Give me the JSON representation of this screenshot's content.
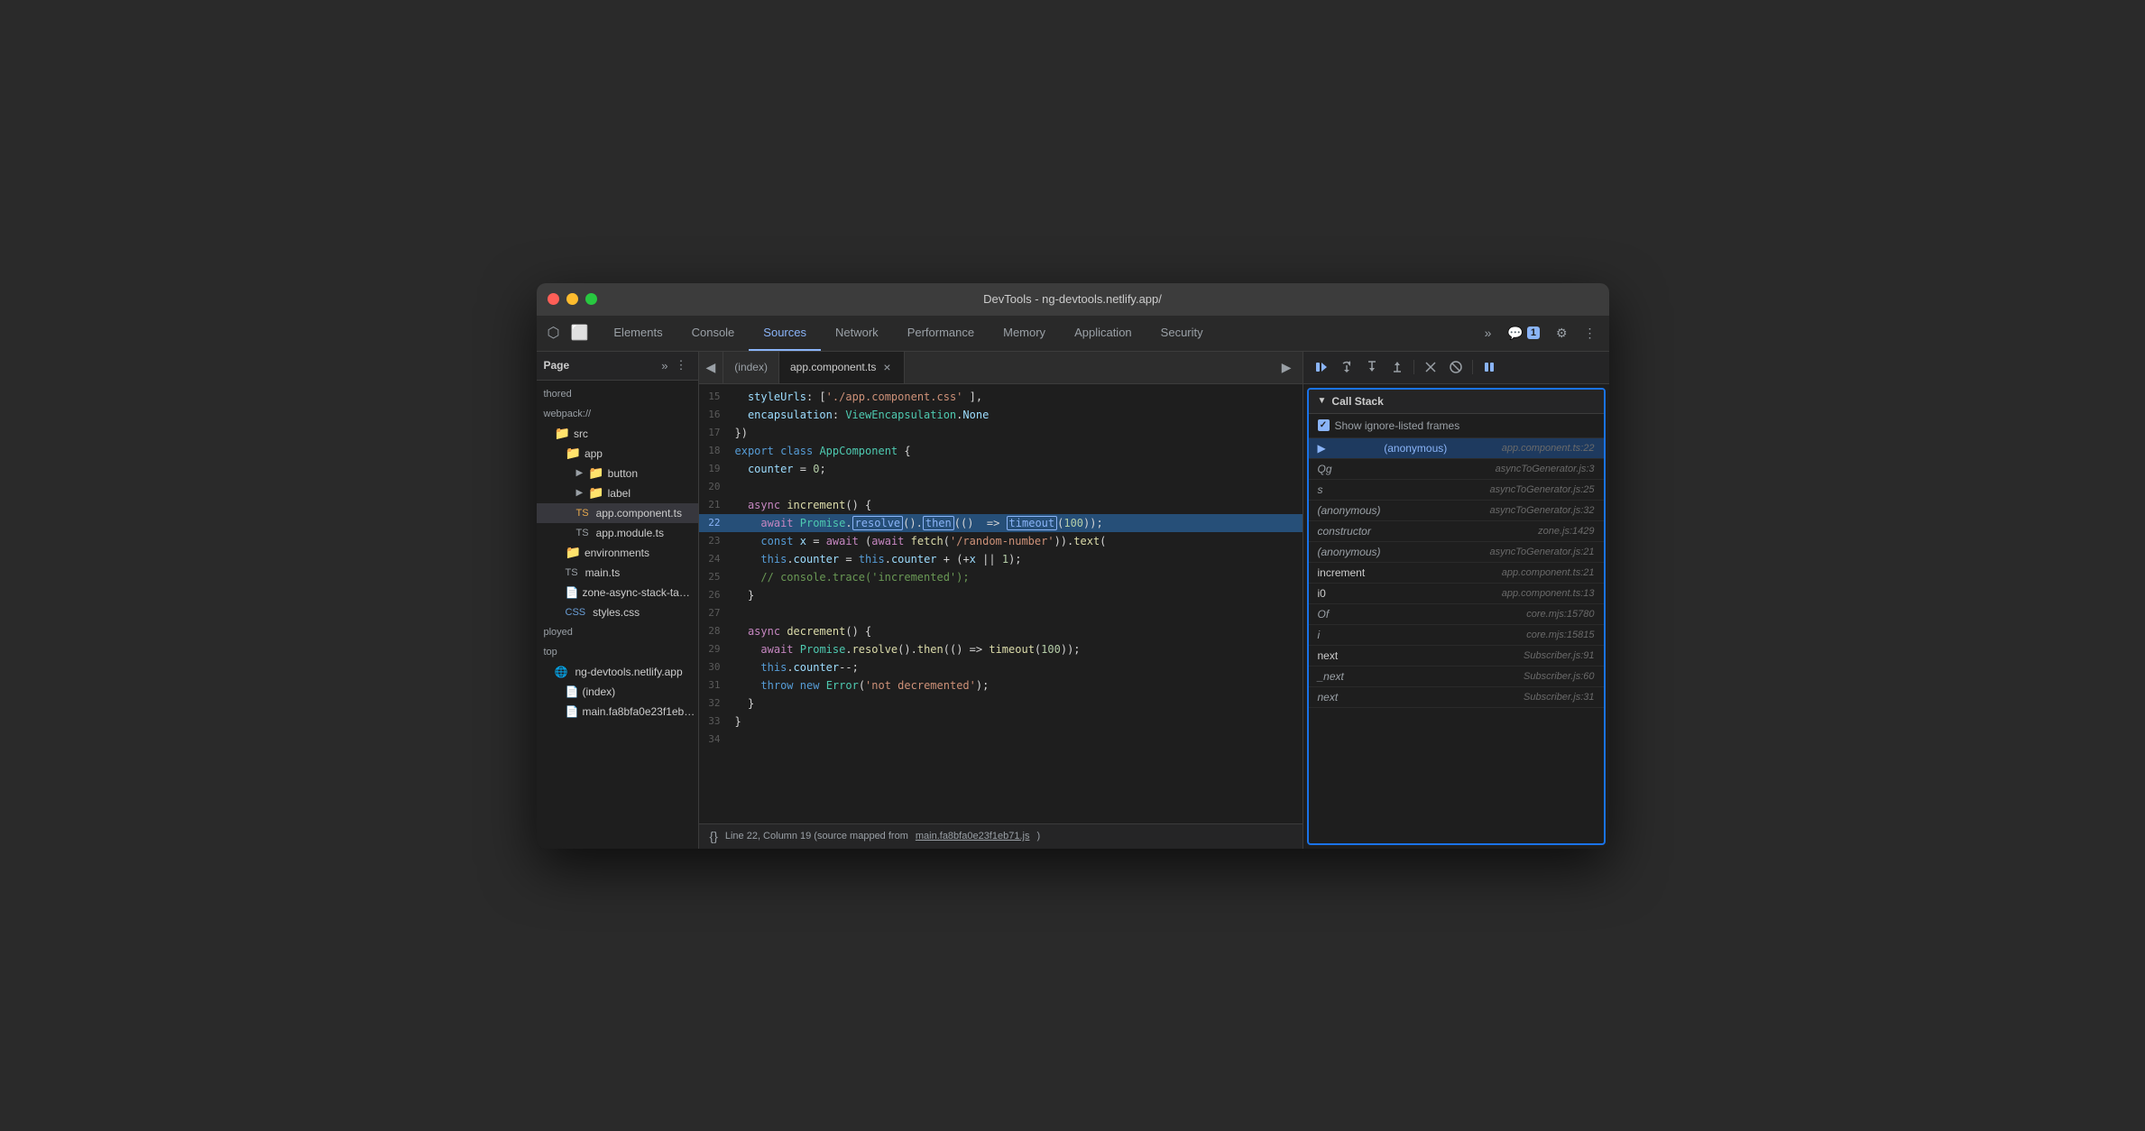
{
  "window": {
    "title": "DevTools - ng-devtools.netlify.app/"
  },
  "tabs": {
    "items": [
      {
        "id": "elements",
        "label": "Elements",
        "active": false
      },
      {
        "id": "console",
        "label": "Console",
        "active": false
      },
      {
        "id": "sources",
        "label": "Sources",
        "active": true
      },
      {
        "id": "network",
        "label": "Network",
        "active": false
      },
      {
        "id": "performance",
        "label": "Performance",
        "active": false
      },
      {
        "id": "memory",
        "label": "Memory",
        "active": false
      },
      {
        "id": "application",
        "label": "Application",
        "active": false
      },
      {
        "id": "security",
        "label": "Security",
        "active": false
      }
    ],
    "more_label": "»",
    "notification_badge": "1",
    "settings_icon": "⚙",
    "more_icon": "⋮"
  },
  "sidebar": {
    "header_label": "Page",
    "more_icon": "»",
    "menu_icon": "⋮",
    "items": [
      {
        "label": "thored",
        "indent": 0,
        "type": "text"
      },
      {
        "label": "webpack://",
        "indent": 0,
        "type": "text"
      },
      {
        "label": "src",
        "indent": 1,
        "type": "folder_orange"
      },
      {
        "label": "app",
        "indent": 2,
        "type": "folder_orange"
      },
      {
        "label": "button",
        "indent": 3,
        "type": "folder_orange",
        "has_arrow": true
      },
      {
        "label": "label",
        "indent": 3,
        "type": "folder_orange",
        "has_arrow": true
      },
      {
        "label": "app.component.ts",
        "indent": 3,
        "type": "file_ts",
        "active": true
      },
      {
        "label": "app.module.ts",
        "indent": 3,
        "type": "file_ts"
      },
      {
        "label": "environments",
        "indent": 2,
        "type": "folder_orange"
      },
      {
        "label": "main.ts",
        "indent": 2,
        "type": "file_ts"
      },
      {
        "label": "zone-async-stack-ta…",
        "indent": 2,
        "type": "file"
      },
      {
        "label": "styles.css",
        "indent": 2,
        "type": "file_css"
      },
      {
        "label": "ployed",
        "indent": 0,
        "type": "text"
      },
      {
        "label": "top",
        "indent": 0,
        "type": "text"
      },
      {
        "label": "ng-devtools.netlify.app",
        "indent": 1,
        "type": "globe"
      },
      {
        "label": "(index)",
        "indent": 2,
        "type": "file"
      },
      {
        "label": "main.fa8bfa0e23f1eb…",
        "indent": 2,
        "type": "file"
      }
    ]
  },
  "editor": {
    "back_btn": "◀",
    "tabs": [
      {
        "label": "(index)",
        "active": false
      },
      {
        "label": "app.component.ts",
        "active": true,
        "closeable": true
      }
    ],
    "lines": [
      {
        "num": 15,
        "content": "  styleUrls: ['./app.component.css' ],",
        "type": "normal"
      },
      {
        "num": 16,
        "content": "  encapsulation: ViewEncapsulation.None",
        "type": "normal"
      },
      {
        "num": 17,
        "content": "})",
        "type": "normal"
      },
      {
        "num": 18,
        "content": "export class AppComponent {",
        "type": "normal"
      },
      {
        "num": 19,
        "content": "  counter = 0;",
        "type": "normal"
      },
      {
        "num": 20,
        "content": "",
        "type": "normal"
      },
      {
        "num": 21,
        "content": "  async increment() {",
        "type": "normal"
      },
      {
        "num": 22,
        "content": "    await Promise.resolve().then(() => timeout(100));",
        "type": "highlighted",
        "has_breakpoint": true
      },
      {
        "num": 23,
        "content": "    const x = await (await fetch('/random-number')).text(",
        "type": "normal"
      },
      {
        "num": 24,
        "content": "    this.counter = this.counter + (+x || 1);",
        "type": "normal"
      },
      {
        "num": 25,
        "content": "    // console.trace('incremented');",
        "type": "normal"
      },
      {
        "num": 26,
        "content": "  }",
        "type": "normal"
      },
      {
        "num": 27,
        "content": "",
        "type": "normal"
      },
      {
        "num": 28,
        "content": "  async decrement() {",
        "type": "normal"
      },
      {
        "num": 29,
        "content": "    await Promise.resolve().then(() => timeout(100));",
        "type": "normal"
      },
      {
        "num": 30,
        "content": "    this.counter--;",
        "type": "normal"
      },
      {
        "num": 31,
        "content": "    throw new Error('not decremented');",
        "type": "normal"
      },
      {
        "num": 32,
        "content": "  }",
        "type": "normal"
      },
      {
        "num": 33,
        "content": "}",
        "type": "normal"
      },
      {
        "num": 34,
        "content": "",
        "type": "normal"
      }
    ]
  },
  "status_bar": {
    "curly": "{}",
    "text": "Line 22, Column 19 (source mapped from",
    "link": "main.fa8bfa0e23f1eb71.js",
    "text2": ")"
  },
  "debugger": {
    "toolbar_buttons": [
      {
        "id": "resume",
        "icon": "▶",
        "label": "Resume",
        "active": true
      },
      {
        "id": "step-over",
        "icon": "↺",
        "label": "Step over"
      },
      {
        "id": "step-into",
        "icon": "↓",
        "label": "Step into"
      },
      {
        "id": "step-out",
        "icon": "↑",
        "label": "Step out"
      },
      {
        "id": "deactivate",
        "icon": "⤢",
        "label": "Deactivate"
      },
      {
        "id": "no-pause",
        "icon": "⊘",
        "label": "No pause"
      },
      {
        "id": "pause",
        "icon": "⏸",
        "label": "Pause",
        "active_blue": true
      }
    ],
    "call_stack": {
      "title": "Call Stack",
      "show_ignored_frames_label": "Show ignore-listed frames",
      "items": [
        {
          "name": "(anonymous)",
          "file": "app.component.ts:22",
          "current": true,
          "italic": false
        },
        {
          "name": "Qg",
          "file": "asyncToGenerator.js:3",
          "current": false,
          "italic": true
        },
        {
          "name": "s",
          "file": "asyncToGenerator.js:25",
          "current": false,
          "italic": true
        },
        {
          "name": "(anonymous)",
          "file": "asyncToGenerator.js:32",
          "current": false,
          "italic": true
        },
        {
          "name": "constructor",
          "file": "zone.js:1429",
          "current": false,
          "italic": true
        },
        {
          "name": "(anonymous)",
          "file": "asyncToGenerator.js:21",
          "current": false,
          "italic": true
        },
        {
          "name": "increment",
          "file": "app.component.ts:21",
          "current": false,
          "italic": false
        },
        {
          "name": "i0",
          "file": "app.component.ts:13",
          "current": false,
          "italic": false
        },
        {
          "name": "Of",
          "file": "core.mjs:15780",
          "current": false,
          "italic": true
        },
        {
          "name": "i",
          "file": "core.mjs:15815",
          "current": false,
          "italic": true
        },
        {
          "name": "next",
          "file": "Subscriber.js:91",
          "current": false,
          "italic": false
        },
        {
          "name": "_next",
          "file": "Subscriber.js:60",
          "current": false,
          "italic": true
        },
        {
          "name": "next",
          "file": "Subscriber.js:31",
          "current": false,
          "italic": true
        }
      ]
    }
  }
}
